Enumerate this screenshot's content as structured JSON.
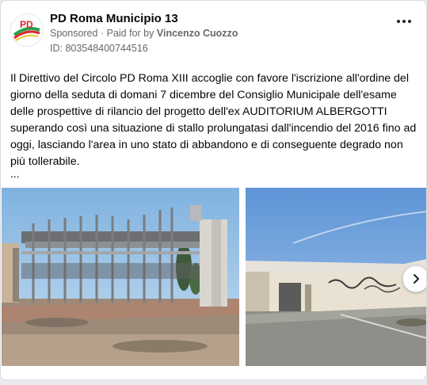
{
  "post": {
    "page_name": "PD Roma Municipio 13",
    "sponsored_label": "Sponsored",
    "separator": "·",
    "paid_for_prefix": "Paid for by",
    "paid_for_name": "Vincenzo Cuozzo",
    "id_text": "ID: 803548400744516",
    "body": "Il Direttivo del Circolo PD Roma XIII accoglie con favore l'iscrizione all'ordine del giorno della seduta di domani 7 dicembre del Consiglio Municipale dell'esame delle prospettive di rilancio del progetto dell'ex AUDITORIUM ALBERGOTTI superando così una situazione di stallo prolungatasi dall'incendio del 2016 fino ad oggi, lasciando l'area in uno stato di abbandono e di conseguente degrado non più tollerabile.",
    "ellipsis": "...",
    "logo_text": "PD"
  },
  "icons": {
    "more": "more-options-icon",
    "next": "chevron-right-icon",
    "avatar": "pd-logo-avatar"
  },
  "colors": {
    "secondary_text": "#65676b",
    "logo_red": "#e3262e",
    "logo_green": "#2aa14a"
  }
}
